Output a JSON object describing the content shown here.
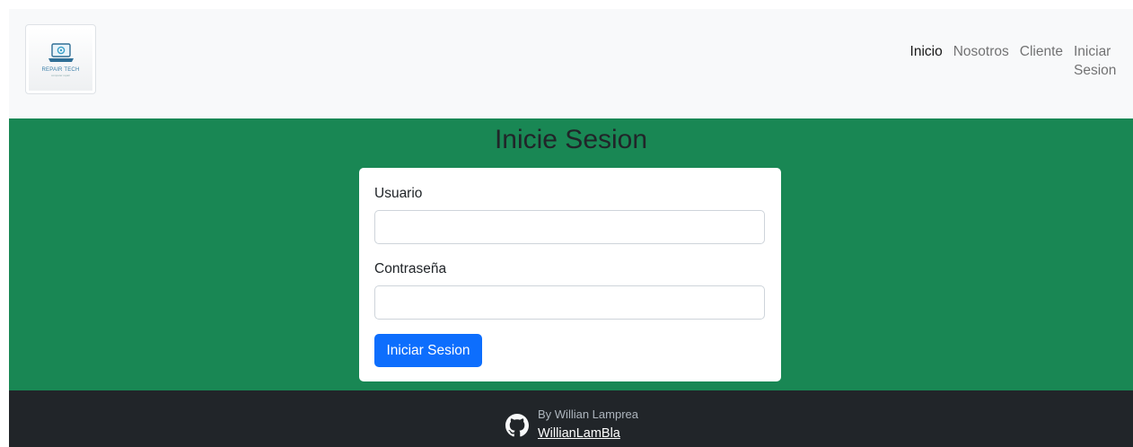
{
  "navbar": {
    "brand": {
      "logo_text": "REPAIR TECH",
      "logo_subtext": "computer repair"
    },
    "links": [
      {
        "label": "Inicio",
        "active": true
      },
      {
        "label": "Nosotros",
        "active": false
      },
      {
        "label": "Cliente",
        "active": false
      },
      {
        "label": "Iniciar Sesion",
        "active": false
      }
    ]
  },
  "main": {
    "title": "Inicie Sesion",
    "form": {
      "username_label": "Usuario",
      "username_value": "",
      "password_label": "Contraseña",
      "password_value": "",
      "submit_label": "Iniciar Sesion"
    }
  },
  "footer": {
    "author": "By Willian Lamprea",
    "github_handle": "WillianLamBla",
    "icon": "github-icon"
  },
  "colors": {
    "navbar_bg": "#f8f9fa",
    "main_bg": "#198754",
    "footer_bg": "#212529",
    "primary": "#0d6efd"
  }
}
